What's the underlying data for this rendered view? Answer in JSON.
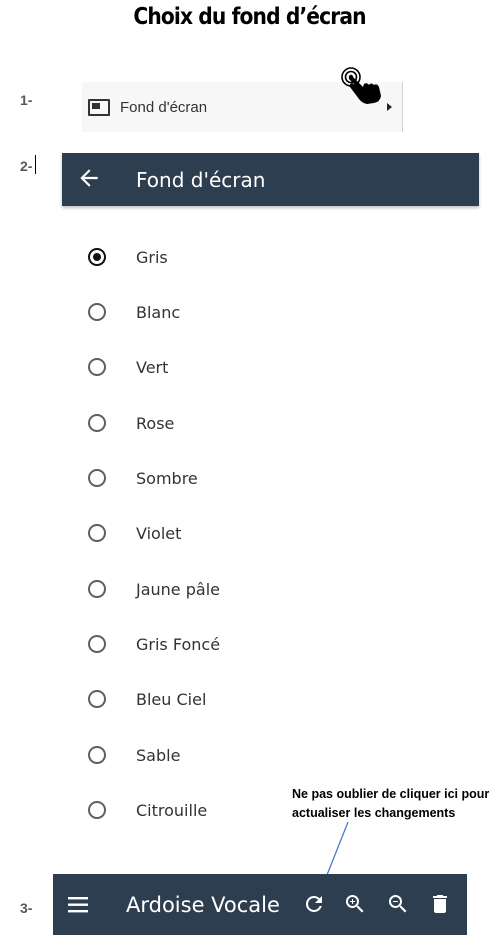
{
  "title": "Choix du fond d’écran",
  "steps": {
    "s1": "1-",
    "s2": "2-",
    "s3": "3-"
  },
  "step1": {
    "label": "Fond d'écran",
    "icon": "wallpaper-icon"
  },
  "step2": {
    "header_title": "Fond d'écran",
    "back_icon": "arrow-left-icon",
    "options": [
      {
        "label": "Gris",
        "checked": true
      },
      {
        "label": "Blanc",
        "checked": false
      },
      {
        "label": "Vert",
        "checked": false
      },
      {
        "label": "Rose",
        "checked": false
      },
      {
        "label": "Sombre",
        "checked": false
      },
      {
        "label": "Violet",
        "checked": false
      },
      {
        "label": "Jaune pâle",
        "checked": false
      },
      {
        "label": "Gris Foncé",
        "checked": false
      },
      {
        "label": "Bleu Ciel",
        "checked": false
      },
      {
        "label": "Sable",
        "checked": false
      },
      {
        "label": "Citrouille",
        "checked": false
      }
    ]
  },
  "annotation": {
    "line1": "Ne pas oublier de cliquer ici pour",
    "line2": "actualiser les changements"
  },
  "step3": {
    "app_title": "Ardoise Vocale",
    "icons": [
      "menu-icon",
      "refresh-icon",
      "zoom-in-icon",
      "zoom-out-icon",
      "trash-icon"
    ]
  },
  "colors": {
    "toolbar": "#2e3e51",
    "text": "#333333",
    "arrow": "#4472c4"
  }
}
